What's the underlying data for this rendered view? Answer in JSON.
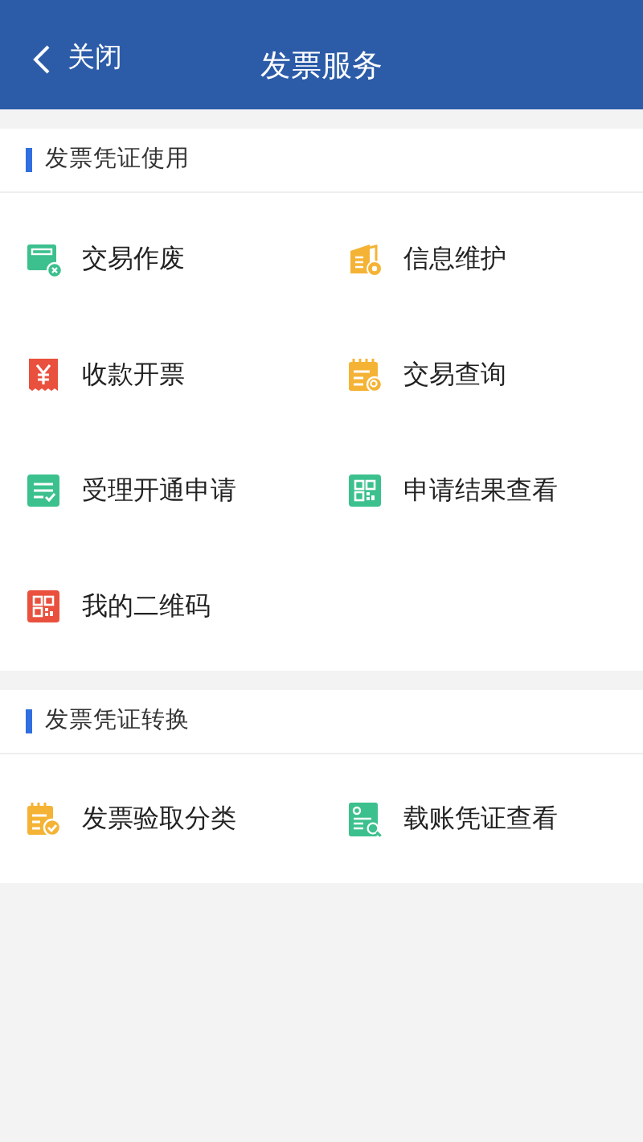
{
  "header": {
    "back_label": "关闭",
    "title": "发票服务"
  },
  "sections": [
    {
      "title": "发票凭证使用",
      "items": [
        {
          "label": "交易作废",
          "kind": "card-x",
          "color": "#3cc08e"
        },
        {
          "label": "信息维护",
          "kind": "docs-gear",
          "color": "#f5b335"
        },
        {
          "label": "收款开票",
          "kind": "yen-receipt",
          "color": "#e9503d"
        },
        {
          "label": "交易查询",
          "kind": "calendar-search",
          "color": "#f5b335"
        },
        {
          "label": "受理开通申请",
          "kind": "list-check",
          "color": "#3cc08e"
        },
        {
          "label": "申请结果查看",
          "kind": "qr",
          "color": "#3cc08e"
        },
        {
          "label": "我的二维码",
          "kind": "qr",
          "color": "#e9503d"
        }
      ]
    },
    {
      "title": "发票凭证转换",
      "items": [
        {
          "label": "发票验取分类",
          "kind": "calendar-check",
          "color": "#f5b335"
        },
        {
          "label": "载账凭证查看",
          "kind": "doc-search",
          "color": "#3cc08e"
        }
      ]
    }
  ]
}
